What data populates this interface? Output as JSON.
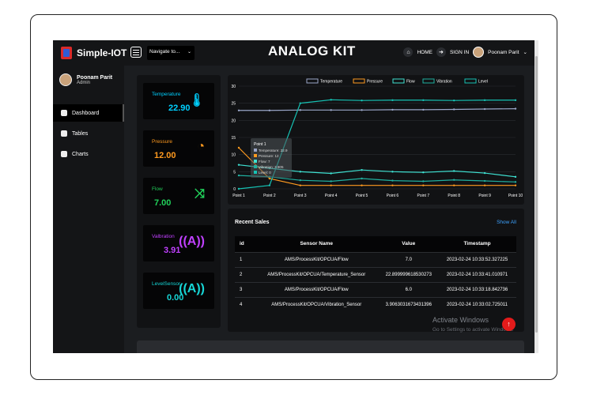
{
  "app": {
    "logo_text": "Simple-IOT",
    "title": "ANALOG KIT"
  },
  "topbar": {
    "navigate_placeholder": "Navigate to...",
    "home_label": "HOME",
    "signin_label": "SIGN IN",
    "user_name": "Poonam Parit"
  },
  "sidebar": {
    "profile_name": "Poonam Parit",
    "profile_role": "Admin",
    "items": [
      {
        "label": "Dashboard",
        "icon": "dashboard-icon",
        "active": true
      },
      {
        "label": "Tables",
        "icon": "table-icon",
        "active": false
      },
      {
        "label": "Charts",
        "icon": "chart-icon",
        "active": false
      }
    ]
  },
  "cards": [
    {
      "label": "Temperature",
      "value": "22.90",
      "color": "#00d0ff",
      "icon": "thermometer-icon"
    },
    {
      "label": "Pressure",
      "value": "12.00",
      "color": "#ff9a1f",
      "icon": "gauge-icon"
    },
    {
      "label": "Flow",
      "value": "7.00",
      "color": "#21d05a",
      "icon": "shuffle-icon"
    },
    {
      "label": "Valbration",
      "value": "3.91",
      "color": "#c040ff",
      "icon": "vibration-icon"
    },
    {
      "label": "LevelSensor",
      "value": "0.00",
      "color": "#16d6d6",
      "icon": "signal-icon"
    }
  ],
  "chart_data": {
    "type": "line",
    "categories": [
      "Point 1",
      "Point 2",
      "Point 3",
      "Point 4",
      "Point 5",
      "Point 6",
      "Point 7",
      "Point 8",
      "Point 9",
      "Point 10"
    ],
    "ylim": [
      0,
      30
    ],
    "yticks": [
      0,
      5,
      10,
      15,
      20,
      25,
      30
    ],
    "legend_position": "top",
    "series": [
      {
        "name": "Temperature",
        "color": "#9aa6c8",
        "values": [
          22.9,
          22.9,
          23,
          23,
          23,
          23.1,
          23.1,
          23.2,
          23.3,
          23.4
        ]
      },
      {
        "name": "Pressure",
        "color": "#ff9a1f",
        "values": [
          12,
          3,
          1,
          1,
          1,
          1,
          1,
          1,
          1,
          1
        ]
      },
      {
        "name": "Flow",
        "color": "#3ee0d1",
        "values": [
          7,
          6,
          5,
          4.5,
          5.5,
          5,
          4.8,
          5.2,
          4.6,
          3.5
        ]
      },
      {
        "name": "Vibration",
        "color": "#20b0a0",
        "values": [
          3.9,
          3.5,
          2.5,
          2.2,
          3,
          2.4,
          2.2,
          2.6,
          2.3,
          2
        ]
      },
      {
        "name": "Level",
        "color": "#16c2b4",
        "values": [
          0,
          1,
          25,
          26,
          25.8,
          25.9,
          25.9,
          25.8,
          25.9,
          25.9
        ]
      }
    ],
    "tooltip": {
      "title": "Point 1",
      "lines": [
        "Temperature: 22.9",
        "Pressure: 12",
        "Flow: 7",
        "Vibration: 3.905",
        "Level: 0"
      ]
    }
  },
  "recent_sales": {
    "title": "Recent Sales",
    "link": "Show All",
    "columns": [
      "id",
      "Sensor Name",
      "Value",
      "Timestamp"
    ],
    "rows": [
      [
        "1",
        "AMS/ProcessKit/OPCUA/Flow",
        "7.0",
        "2023-02-24 10:33:52.327225"
      ],
      [
        "2",
        "AMS/ProcessKit/OPCUA/Temperature_Sensor",
        "22.899999618530273",
        "2023-02-24 10:33:41.010971"
      ],
      [
        "3",
        "AMS/ProcessKit/OPCUA/Flow",
        "6.0",
        "2023-02-24 10:33:18.842736"
      ],
      [
        "4",
        "AMS/ProcessKit/OPCUA/Vibration_Sensor",
        "3.9063031673431396",
        "2023-02-24 10:33:02.725011"
      ]
    ]
  },
  "watermark": {
    "line1": "Activate Windows",
    "line2": "Go to Settings to activate Windows."
  },
  "fab_symbol": "↑"
}
